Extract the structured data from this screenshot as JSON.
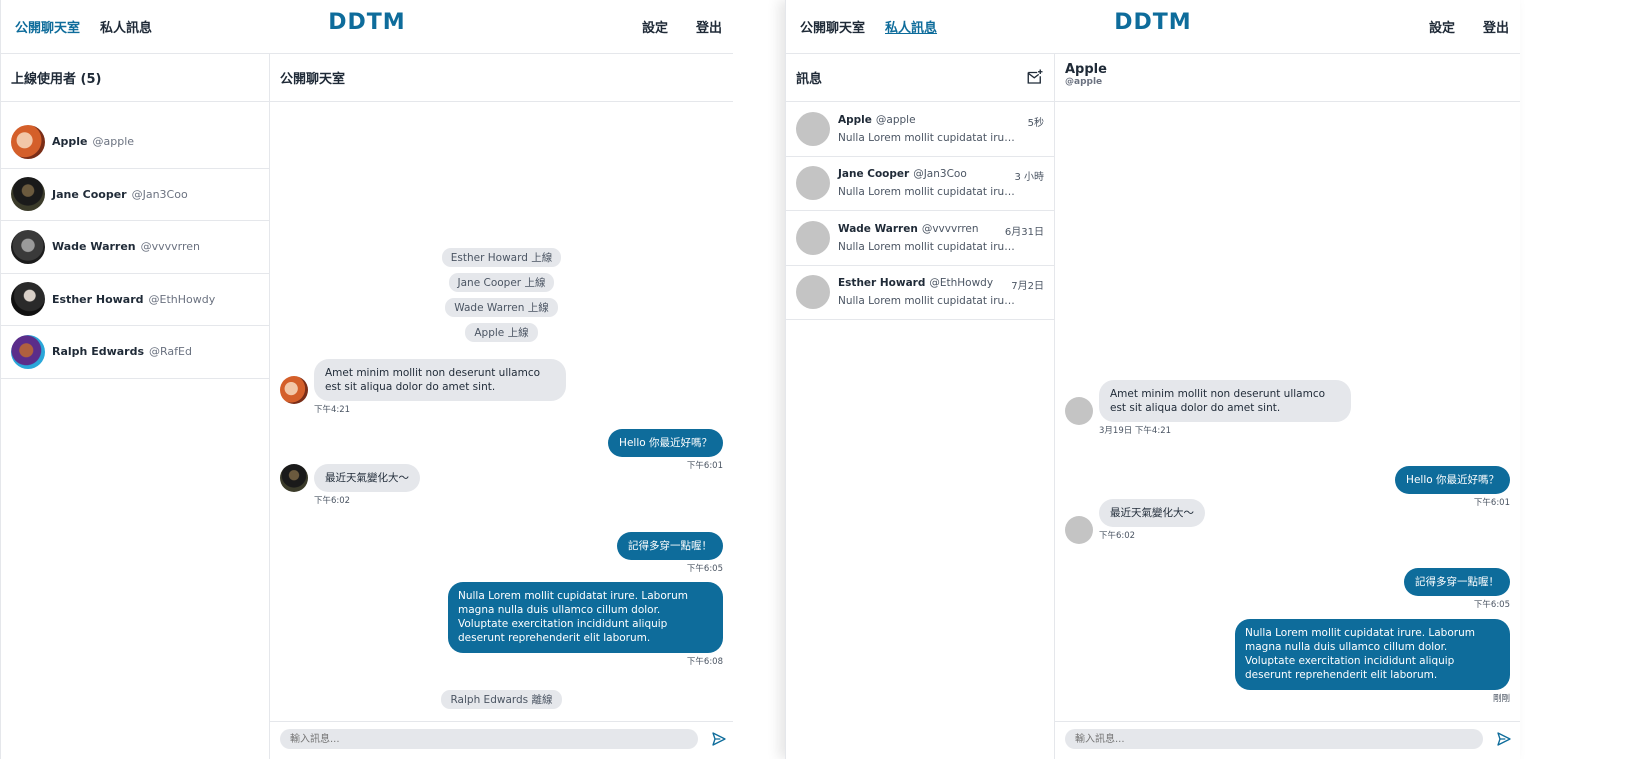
{
  "brand": "DDTM",
  "nav": {
    "public_chat": "公開聊天室",
    "private_msg": "私人訊息",
    "settings": "設定",
    "logout": "登出"
  },
  "colors": {
    "accent": "#0e6c9b",
    "bubble_in": "#e5e7eb",
    "bubble_out": "#0e6c9b"
  },
  "left": {
    "online_title": "上線使用者 (5)",
    "chat_title": "公開聊天室",
    "users": [
      {
        "name": "Apple",
        "handle": "@apple"
      },
      {
        "name": "Jane Cooper",
        "handle": "@Jan3Coo"
      },
      {
        "name": "Wade Warren",
        "handle": "@vvvvrren"
      },
      {
        "name": "Esther Howard",
        "handle": "@EthHowdy"
      },
      {
        "name": "Ralph Edwards",
        "handle": "@RafEd"
      }
    ],
    "system": [
      "Esther Howard 上線",
      "Jane Cooper 上線",
      "Wade Warren 上線",
      "Apple 上線",
      "Ralph Edwards 離線"
    ],
    "messages": [
      {
        "text": "Amet minim mollit non deserunt ullamco est sit aliqua dolor do amet sint.",
        "time": "下午4:21"
      },
      {
        "text": "Hello 你最近好嗎？",
        "time": "下午6:01"
      },
      {
        "text": "最近天氣變化大～",
        "time": "下午6:02"
      },
      {
        "text": "記得多穿一點喔！",
        "time": "下午6:05"
      },
      {
        "text": "Nulla Lorem mollit cupidatat irure. Laborum magna nulla duis ullamco cillum dolor. Voluptate exercitation incididunt aliquip deserunt reprehenderit elit laborum.",
        "time": "下午6:08"
      }
    ],
    "input_placeholder": "輸入訊息..."
  },
  "right": {
    "dm_title": "訊息",
    "chat_name": "Apple",
    "chat_handle": "@apple",
    "conversations": [
      {
        "name": "Apple",
        "handle": "@apple",
        "time": "5秒",
        "preview": "Nulla Lorem mollit cupidatat irure...."
      },
      {
        "name": "Jane Cooper",
        "handle": "@Jan3Coo",
        "time": "3 小時",
        "preview": "Nulla Lorem mollit cupidatat irure...."
      },
      {
        "name": "Wade Warren",
        "handle": "@vvvvrren",
        "time": "6月31日",
        "preview": "Nulla Lorem mollit cupidatat irure...."
      },
      {
        "name": "Esther Howard",
        "handle": "@EthHowdy",
        "time": "7月2日",
        "preview": "Nulla Lorem mollit cupidatat irure...."
      }
    ],
    "messages": [
      {
        "text": "Amet minim mollit non deserunt ullamco est sit aliqua dolor do amet sint.",
        "time": "3月19日 下午4:21"
      },
      {
        "text": "Hello 你最近好嗎？",
        "time": "下午6:01"
      },
      {
        "text": "最近天氣變化大～",
        "time": "下午6:02"
      },
      {
        "text": "記得多穿一點喔！",
        "time": "下午6:05"
      },
      {
        "text": "Nulla Lorem mollit cupidatat irure. Laborum magna nulla duis ullamco cillum dolor. Voluptate exercitation incididunt aliquip deserunt reprehenderit elit laborum.",
        "time": "剛剛"
      }
    ],
    "input_placeholder": "輸入訊息..."
  }
}
